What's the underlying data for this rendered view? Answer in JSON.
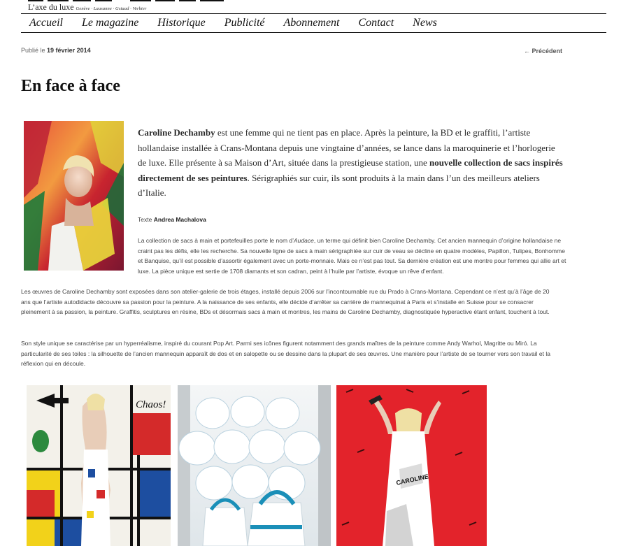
{
  "site": {
    "tagline_main": "L’axe du luxe",
    "tagline_cities": "Genève · Lausanne · Gstaad · Verbier"
  },
  "nav": {
    "items": [
      {
        "label": "Accueil"
      },
      {
        "label": "Le magazine"
      },
      {
        "label": "Historique"
      },
      {
        "label": "Publicité"
      },
      {
        "label": "Abonnement"
      },
      {
        "label": "Contact"
      },
      {
        "label": "News"
      }
    ]
  },
  "post": {
    "published_prefix": "Publié le",
    "published_date": "19 février 2014",
    "prev_link": "← Précédent",
    "title": "En face à face",
    "lead": {
      "name": "Caroline Dechamby",
      "text1": " est une femme qui ne tient pas en place. Après la peinture, la BD et le graffiti, l’artiste hollandaise installée à Crans-Montana depuis une vingtaine d’années, se lance dans la maroquinerie et l’horlogerie de luxe. Elle présente à sa Maison d’Art, située dans la prestigieuse station, une ",
      "bold2": "nouvelle collection de sacs inspirés directement de ses peintures",
      "text2": ". Sérigraphiés sur cuir, ils sont produits à la main dans l’un des meilleurs ateliers d’Italie."
    },
    "credit_prefix": "Texte",
    "credit_author": "Andrea Machalova",
    "para1_a": "La collection de sacs à main et portefeuilles porte le nom d’",
    "para1_italic": "Audace",
    "para1_b": ", un terme qui définit bien Caroline Dechamby. Cet ancien mannequin d’origine hollandaise ne craint pas les défis, elle les recherche. Sa nouvelle ligne de sacs à main sérigraphiée sur cuir de veau se décline en quatre modèles, Papillon, Tulipes, Bonhomme et Banquise, qu’il est possible d’assortir également avec un porte-monnaie. Mais ce n’est pas tout. Sa dernière création est une montre pour femmes qui allie art et luxe. La pièce unique est sertie de 1708 diamants et son cadran, peint à l’huile par l’artiste, évoque un rêve d’enfant.",
    "para2": "Les œuvres de Caroline Dechamby sont exposées dans son atelier-galerie de trois étages, installé depuis 2006 sur l’incontournable rue du Prado à Crans-Montana. Cependant ce n’est qu’à l’âge de 20 ans que l’artiste autodidacte découvre sa passion pour la peinture. A la naissance de ses enfants, elle décide d’arrêter sa carrière de mannequinat à Paris et s’installe en Suisse pour se consacrer pleinement à sa passion, la peinture. Graffitis, sculptures en résine, BDs et désormais sacs à main et montres, les mains de Caroline Dechamby, diagnostiquée hyperactive étant enfant, touchent à tout.",
    "para3": "Son style unique se caractérise par un hyperréalisme, inspiré du courant Pop Art. Parmi ses icônes figurent notamment des grands maîtres de la peinture comme Andy Warhol, Magritte ou Miró. La particularité de ses toiles : la silhouette de l’ancien mannequin apparaît de dos et en salopette ou se dessine dans la plupart de ses œuvres. Une manière pour l’artiste de se tourner vers son travail et la réflexion qui en découle."
  },
  "gallery": {
    "chaos_text": "Chaos!",
    "sign_text": "CAROLINE"
  },
  "colors": {
    "nav_border": "#1a1a1a",
    "red_bg": "#e3232b",
    "mondrian_red": "#d42a2a",
    "mondrian_blue": "#1d4ea0",
    "mondrian_yellow": "#f2d21a"
  }
}
